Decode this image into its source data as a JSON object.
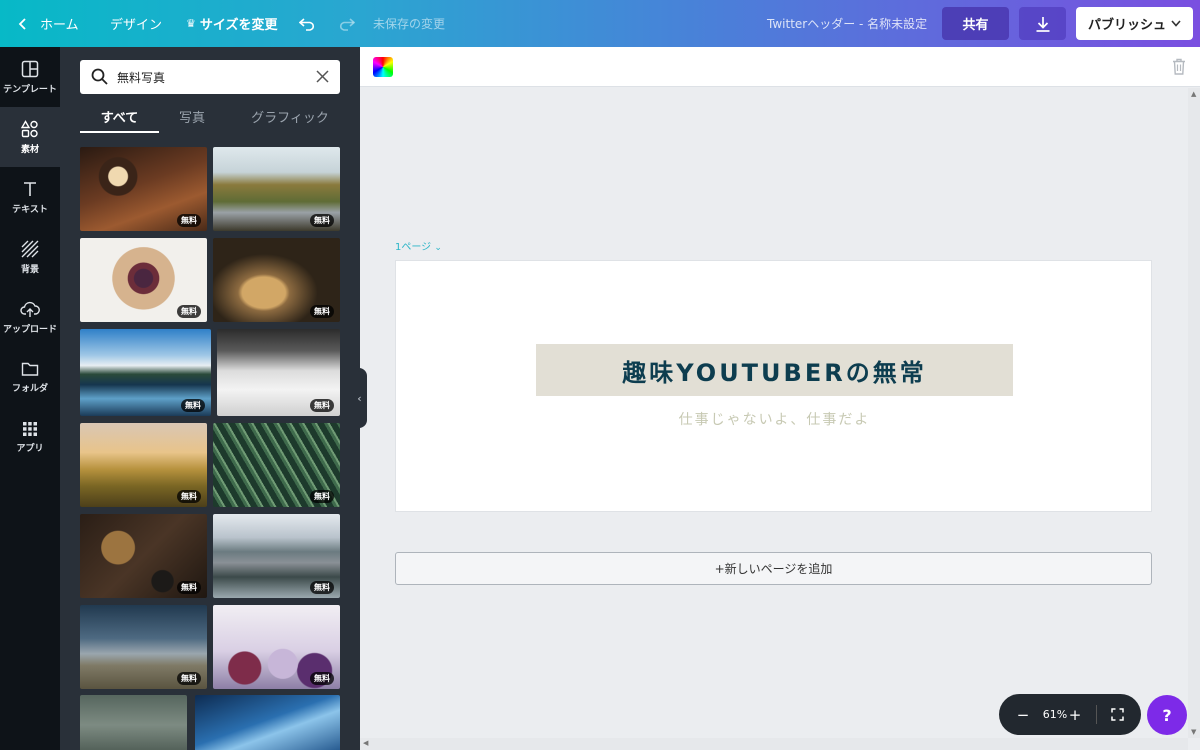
{
  "topbar": {
    "home": "ホーム",
    "design": "デザイン",
    "resize": "サイズを変更",
    "unsaved": "未保存の変更",
    "doc_title": "Twitterヘッダー - 名称未設定",
    "share": "共有",
    "publish": "パブリッシュ"
  },
  "rail": {
    "items": [
      {
        "label": "テンプレート",
        "icon": "template-icon"
      },
      {
        "label": "素材",
        "icon": "elements-icon"
      },
      {
        "label": "テキスト",
        "icon": "text-icon"
      },
      {
        "label": "背景",
        "icon": "background-icon"
      },
      {
        "label": "アップロード",
        "icon": "upload-icon"
      },
      {
        "label": "フォルダ",
        "icon": "folder-icon"
      },
      {
        "label": "アプリ",
        "icon": "apps-icon"
      }
    ]
  },
  "panel": {
    "search_value": "無料写真",
    "tabs": [
      "すべて",
      "写真",
      "グラフィック"
    ],
    "free_badge": "無料"
  },
  "canvas": {
    "page_label": "1ページ",
    "title": "趣味YOUTUBERの無常",
    "subtitle": "仕事じゃないよ、仕事だよ",
    "add_page": "+新しいページを追加"
  },
  "zoom": {
    "level": "61%"
  },
  "help": "?",
  "colors": {
    "accent": "#2ab5c7",
    "help_button": "#7d2ae8",
    "panel": "#293039",
    "rail": "#0e1318"
  }
}
